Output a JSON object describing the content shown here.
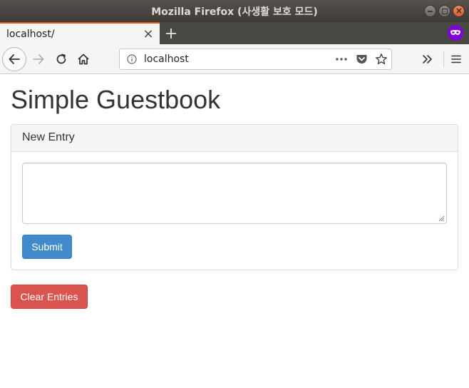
{
  "window": {
    "title": "Mozilla Firefox (사생활 보호 모드)"
  },
  "tabs": [
    {
      "title": "localhost/"
    }
  ],
  "navbar": {
    "url": "localhost",
    "icons": [
      "back-icon",
      "forward-icon",
      "reload-icon",
      "home-icon",
      "info-icon",
      "page-actions-icon",
      "pocket-icon",
      "bookmark-star-icon",
      "overflow-icon",
      "hamburger-menu-icon"
    ]
  },
  "page": {
    "title": "Simple Guestbook",
    "panel": {
      "heading": "New Entry",
      "textarea_value": "",
      "submit_label": "Submit"
    },
    "clear_label": "Clear Entries"
  },
  "colors": {
    "primary": "#428bca",
    "danger": "#d9534f",
    "private_badge": "#8000d7",
    "tab_accent": "#e95420"
  }
}
